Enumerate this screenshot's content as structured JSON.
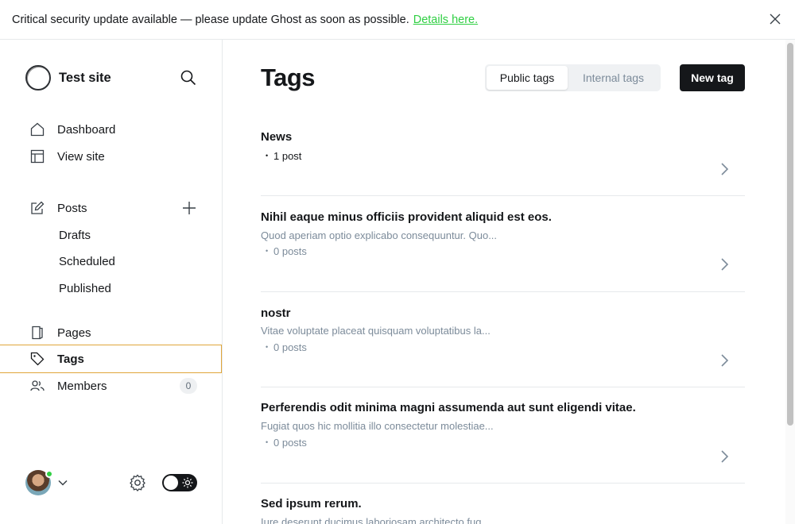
{
  "banner": {
    "message": "Critical security update available — please update Ghost as soon as possible.",
    "link_label": "Details here."
  },
  "sidebar": {
    "site_title": "Test site",
    "nav": {
      "dashboard": "Dashboard",
      "view_site": "View site",
      "posts": "Posts",
      "drafts": "Drafts",
      "scheduled": "Scheduled",
      "published": "Published",
      "pages": "Pages",
      "tags": "Tags",
      "members": "Members"
    },
    "members_count": "0"
  },
  "main": {
    "title": "Tags",
    "tabs": [
      "Public tags",
      "Internal tags"
    ],
    "new_tag_label": "New tag",
    "tags": [
      {
        "name": "News",
        "description": "",
        "count": "1 post"
      },
      {
        "name": "Nihil eaque minus officiis provident aliquid est eos.",
        "description": "Quod aperiam optio explicabo consequuntur. Quo...",
        "count": "0 posts"
      },
      {
        "name": "nostr",
        "description": "Vitae voluptate placeat quisquam voluptatibus la...",
        "count": "0 posts"
      },
      {
        "name": "Perferendis odit minima magni assumenda aut sunt eligendi vitae.",
        "description": "Fugiat quos hic mollitia illo consectetur molestiae...",
        "count": "0 posts"
      },
      {
        "name": "Sed ipsum rerum.",
        "description": "Iure deserunt ducimus laboriosam architecto fug...",
        "count": ""
      }
    ]
  },
  "colors": {
    "accent_green": "#30cf43",
    "active_border": "#e0a63a",
    "primary_button": "#15171a"
  }
}
